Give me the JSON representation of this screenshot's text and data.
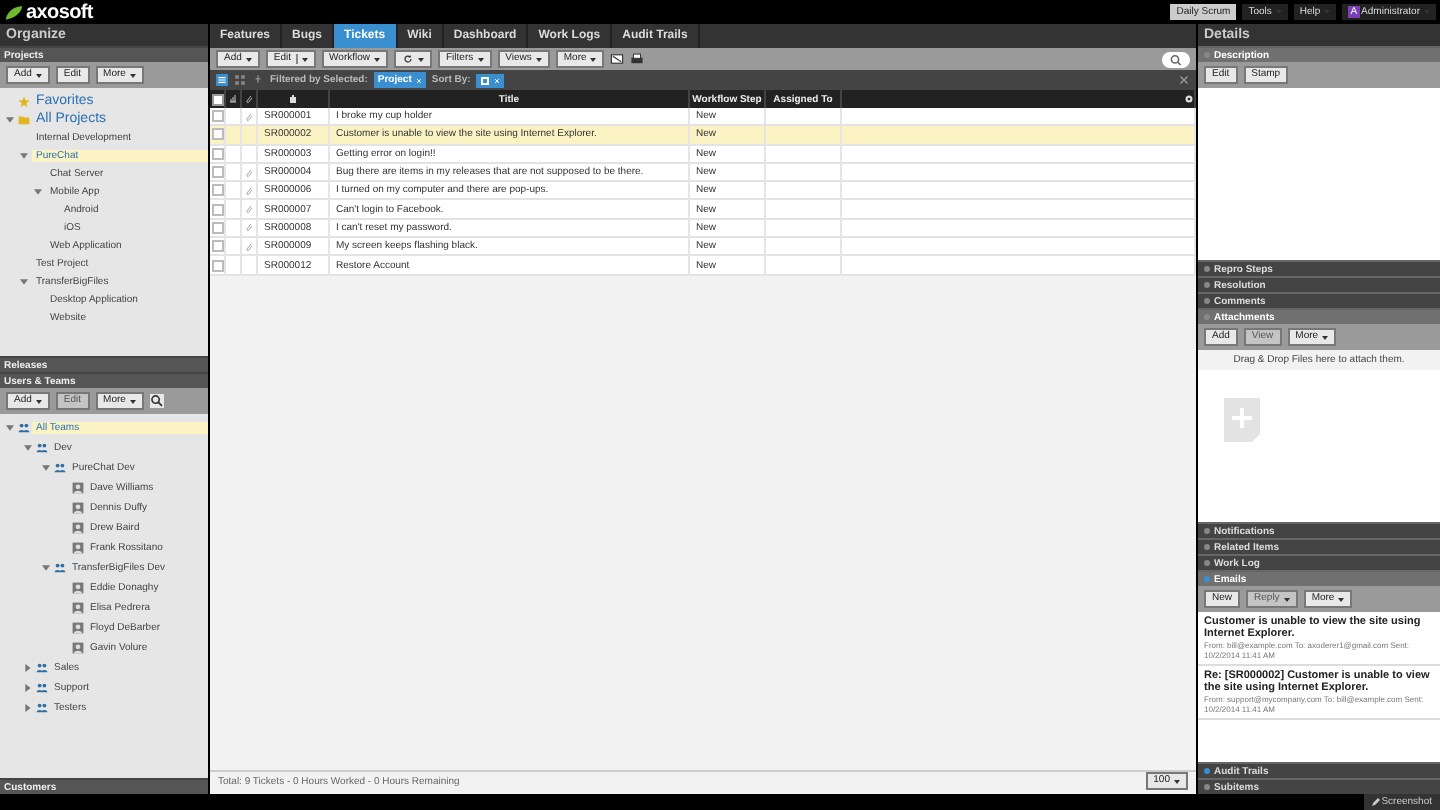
{
  "topbar": {
    "logo": "axosoft",
    "daily_button": "Daily Scrum",
    "menus": [
      {
        "label": "Tools",
        "kind": "menu"
      },
      {
        "label": "Help",
        "kind": "menu"
      },
      {
        "label": "Administrator",
        "kind": "user",
        "avatar": "A"
      }
    ]
  },
  "organize": {
    "title": "Organize",
    "projects": {
      "title": "Projects",
      "toolbar": [
        {
          "label": "Add",
          "caret": true,
          "disabled": false
        },
        {
          "label": "Edit",
          "caret": false,
          "disabled": false
        },
        {
          "label": "More",
          "caret": true,
          "disabled": false
        }
      ],
      "tree": [
        {
          "label": "Favorites",
          "kind": "favorites",
          "selected": false
        },
        {
          "label": "All Projects",
          "kind": "root",
          "selected": false,
          "expanded": true,
          "children": [
            {
              "label": "Internal Development",
              "selected": false
            },
            {
              "label": "PureChat",
              "selected": true,
              "expanded": true,
              "children": [
                {
                  "label": "Chat Server",
                  "selected": false
                },
                {
                  "label": "Mobile App",
                  "selected": false,
                  "expanded": true,
                  "children": [
                    {
                      "label": "Android",
                      "selected": false
                    },
                    {
                      "label": "iOS",
                      "selected": false
                    }
                  ]
                },
                {
                  "label": "Web Application",
                  "selected": false
                }
              ]
            },
            {
              "label": "Test Project",
              "selected": false
            },
            {
              "label": "TransferBigFiles",
              "selected": false,
              "expanded": true,
              "children": [
                {
                  "label": "Desktop Application",
                  "selected": false
                },
                {
                  "label": "Website",
                  "selected": false
                }
              ]
            }
          ]
        }
      ]
    },
    "releases": {
      "title": "Releases"
    },
    "users": {
      "title": "Users & Teams",
      "toolbar": [
        {
          "label": "Add",
          "caret": true,
          "disabled": false
        },
        {
          "label": "Edit",
          "caret": false,
          "disabled": true
        },
        {
          "label": "More",
          "caret": true,
          "disabled": false
        }
      ],
      "tree": [
        {
          "label": "All Teams",
          "kind": "team",
          "selected": true,
          "expanded": true,
          "children": [
            {
              "label": "Dev",
              "kind": "team",
              "selected": false,
              "expanded": true,
              "children": [
                {
                  "label": "PureChat Dev",
                  "kind": "team",
                  "selected": false,
                  "expanded": true,
                  "children": [
                    {
                      "label": "Dave Williams",
                      "kind": "person",
                      "selected": false
                    },
                    {
                      "label": "Dennis Duffy",
                      "kind": "person",
                      "selected": false
                    },
                    {
                      "label": "Drew Baird",
                      "kind": "person",
                      "selected": false
                    },
                    {
                      "label": "Frank Rossitano",
                      "kind": "person",
                      "selected": false
                    }
                  ]
                },
                {
                  "label": "TransferBigFiles Dev",
                  "kind": "team",
                  "selected": false,
                  "expanded": true,
                  "children": [
                    {
                      "label": "Eddie Donaghy",
                      "kind": "person",
                      "selected": false
                    },
                    {
                      "label": "Elisa Pedrera",
                      "kind": "person",
                      "selected": false
                    },
                    {
                      "label": "Floyd DeBarber",
                      "kind": "person",
                      "selected": false
                    },
                    {
                      "label": "Gavin Volure",
                      "kind": "person",
                      "selected": false
                    }
                  ]
                }
              ]
            },
            {
              "label": "Sales",
              "kind": "team",
              "selected": false,
              "expanded": false
            },
            {
              "label": "Support",
              "kind": "team",
              "selected": false,
              "expanded": false
            },
            {
              "label": "Testers",
              "kind": "team",
              "selected": false,
              "expanded": false
            }
          ]
        }
      ]
    },
    "customers": {
      "title": "Customers"
    }
  },
  "tabs": [
    {
      "label": "Features",
      "selected": false
    },
    {
      "label": "Bugs",
      "selected": false
    },
    {
      "label": "Tickets",
      "selected": true
    },
    {
      "label": "Wiki",
      "selected": false
    },
    {
      "label": "Dashboard",
      "selected": false
    },
    {
      "label": "Work Logs",
      "selected": false
    },
    {
      "label": "Audit Trails",
      "selected": false
    }
  ],
  "toolbar": [
    {
      "label": "Add",
      "kind": "menu"
    },
    {
      "label": "Edit",
      "kind": "split"
    },
    {
      "label": "Workflow",
      "kind": "menu"
    },
    {
      "kind": "refresh"
    },
    {
      "label": "Filters",
      "kind": "menu"
    },
    {
      "label": "Views",
      "kind": "menu"
    },
    {
      "label": "More",
      "kind": "menu"
    }
  ],
  "filter_bar": {
    "filtered_label": "Filtered by Selected:",
    "filter_chip": "Project",
    "sort_label": "Sort By:"
  },
  "table": {
    "select_all_checked": false,
    "columns": [
      "Title",
      "Workflow Step",
      "Assigned To"
    ],
    "rows": [
      {
        "id": "SR000001",
        "title": "I broke my cup holder",
        "step": "New",
        "attachment": true,
        "selected": false,
        "checked": false
      },
      {
        "id": "SR000002",
        "title": "Customer is unable to view the site using Internet Explorer.",
        "step": "New",
        "attachment": false,
        "selected": true,
        "checked": false
      },
      {
        "id": "SR000003",
        "title": "Getting error on login!!",
        "step": "New",
        "attachment": false,
        "selected": false,
        "checked": false
      },
      {
        "id": "SR000004",
        "title": "Bug there are items in my releases that are not supposed to be there.",
        "step": "New",
        "attachment": true,
        "selected": false,
        "checked": false
      },
      {
        "id": "SR000006",
        "title": "I turned on my computer and there are pop-ups.",
        "step": "New",
        "attachment": true,
        "selected": false,
        "checked": false
      },
      {
        "id": "SR000007",
        "title": "Can't login to Facebook.",
        "step": "New",
        "attachment": true,
        "selected": false,
        "checked": false
      },
      {
        "id": "SR000008",
        "title": "I can't reset my password.",
        "step": "New",
        "attachment": true,
        "selected": false,
        "checked": false
      },
      {
        "id": "SR000009",
        "title": "My screen keeps flashing black.",
        "step": "New",
        "attachment": true,
        "selected": false,
        "checked": false
      },
      {
        "id": "SR000012",
        "title": "Restore Account",
        "step": "New",
        "attachment": false,
        "selected": false,
        "checked": false
      }
    ]
  },
  "status_bar": {
    "summary": "Total: 9 Tickets - 0 Hours Worked - 0 Hours Remaining",
    "page_size": "100"
  },
  "details": {
    "title": "Details",
    "sections": [
      {
        "title": "Description",
        "expanded": true,
        "has_items": false,
        "kind": "description",
        "toolbar": [
          {
            "label": "Edit",
            "disabled": false,
            "caret": false
          },
          {
            "label": "Stamp",
            "disabled": false,
            "caret": false
          }
        ]
      },
      {
        "title": "Repro Steps",
        "expanded": false,
        "has_items": false
      },
      {
        "title": "Resolution",
        "expanded": false,
        "has_items": false
      },
      {
        "title": "Comments",
        "expanded": false,
        "has_items": false
      },
      {
        "title": "Attachments",
        "expanded": true,
        "has_items": false,
        "kind": "attachments",
        "toolbar": [
          {
            "label": "Add",
            "disabled": false,
            "caret": false
          },
          {
            "label": "View",
            "disabled": true,
            "caret": false
          },
          {
            "label": "More",
            "disabled": false,
            "caret": true
          }
        ],
        "drop_text": "Drag & Drop Files here to attach them."
      },
      {
        "title": "Notifications",
        "expanded": false,
        "has_items": false
      },
      {
        "title": "Related Items",
        "expanded": false,
        "has_items": false
      },
      {
        "title": "Work Log",
        "expanded": false,
        "has_items": false
      },
      {
        "title": "Emails",
        "expanded": true,
        "has_items": true,
        "kind": "emails",
        "toolbar": [
          {
            "label": "New",
            "disabled": false,
            "caret": false
          },
          {
            "label": "Reply",
            "disabled": true,
            "caret": true
          },
          {
            "label": "More",
            "disabled": false,
            "caret": true
          }
        ],
        "emails": [
          {
            "subject": "Customer is unable to view the site using Internet Explorer.",
            "meta": "From: bill@example.com To: axoderer1@gmail.com Sent: 10/2/2014 11:41 AM"
          },
          {
            "subject": "Re: [SR000002] Customer is unable to view the site using Internet Explorer.",
            "meta": "From: support@mycompany.com To: bill@example.com Sent: 10/2/2014 11:41 AM"
          }
        ]
      },
      {
        "title": "Audit Trails",
        "expanded": false,
        "has_items": true
      },
      {
        "title": "Subitems",
        "expanded": false,
        "has_items": false
      }
    ]
  },
  "footer": {
    "screenshot_button": "Screenshot"
  }
}
